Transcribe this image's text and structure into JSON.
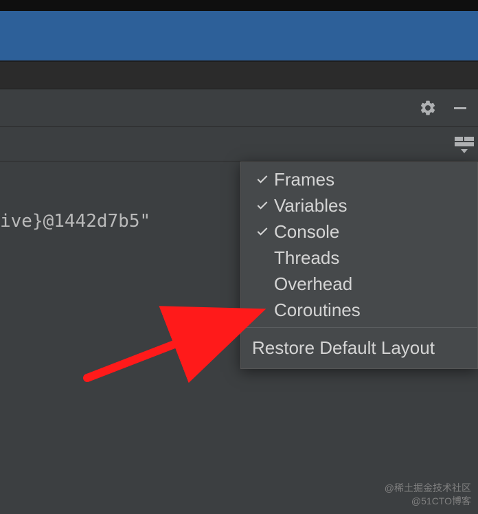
{
  "code_fragment": "ive}@1442d7b5\"",
  "menu": {
    "items": [
      {
        "label": "Frames",
        "checked": true
      },
      {
        "label": "Variables",
        "checked": true
      },
      {
        "label": "Console",
        "checked": true
      },
      {
        "label": "Threads",
        "checked": false
      },
      {
        "label": "Overhead",
        "checked": false
      },
      {
        "label": "Coroutines",
        "checked": false
      }
    ],
    "restore_label": "Restore Default Layout"
  },
  "watermark": {
    "line1": "@稀土掘金技术社区",
    "line2": "@51CTO博客"
  }
}
